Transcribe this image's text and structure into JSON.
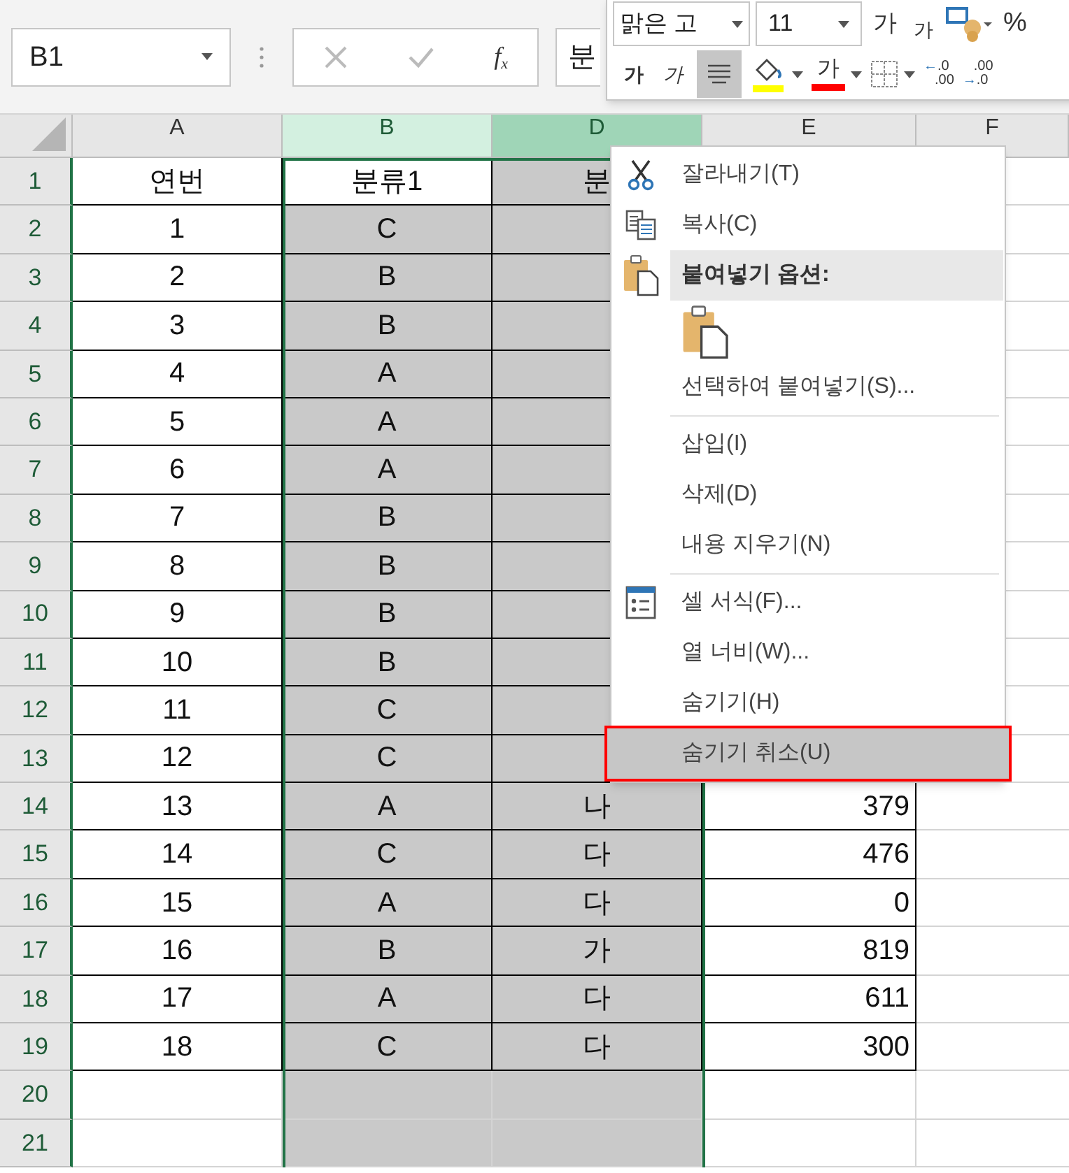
{
  "name_box": {
    "value": "B1"
  },
  "formula_bar": {
    "value": "분",
    "function_icon": [
      "f",
      "x"
    ]
  },
  "mini_toolbar": {
    "font": "맑은 고",
    "size": "11",
    "grow_font": "가",
    "shrink_font": "가",
    "percent": "%",
    "bold": "가",
    "italic": "가",
    "align_center_selected": true,
    "font_color": "가",
    "increase_decimal": [
      "←",
      ".0",
      ".00"
    ],
    "decrease_decimal": [
      ".00",
      "→",
      ".0"
    ]
  },
  "columns": [
    {
      "label": "A",
      "selected": false
    },
    {
      "label": "B",
      "selected": true,
      "active": false
    },
    {
      "label": "D",
      "selected": true,
      "active": true
    },
    {
      "label": "E",
      "selected": false
    },
    {
      "label": "F",
      "selected": false
    }
  ],
  "rows": [
    {
      "num": "1",
      "a": "연번",
      "b": "분류1",
      "d": "분"
    },
    {
      "num": "2",
      "a": "1",
      "b": "C"
    },
    {
      "num": "3",
      "a": "2",
      "b": "B"
    },
    {
      "num": "4",
      "a": "3",
      "b": "B"
    },
    {
      "num": "5",
      "a": "4",
      "b": "A"
    },
    {
      "num": "6",
      "a": "5",
      "b": "A"
    },
    {
      "num": "7",
      "a": "6",
      "b": "A"
    },
    {
      "num": "8",
      "a": "7",
      "b": "B"
    },
    {
      "num": "9",
      "a": "8",
      "b": "B"
    },
    {
      "num": "10",
      "a": "9",
      "b": "B"
    },
    {
      "num": "11",
      "a": "10",
      "b": "B"
    },
    {
      "num": "12",
      "a": "11",
      "b": "C"
    },
    {
      "num": "13",
      "a": "12",
      "b": "C"
    },
    {
      "num": "14",
      "a": "13",
      "b": "A",
      "d": "나",
      "e": "379"
    },
    {
      "num": "15",
      "a": "14",
      "b": "C",
      "d": "다",
      "e": "476"
    },
    {
      "num": "16",
      "a": "15",
      "b": "A",
      "d": "다",
      "e": "0"
    },
    {
      "num": "17",
      "a": "16",
      "b": "B",
      "d": "가",
      "e": "819"
    },
    {
      "num": "18",
      "a": "17",
      "b": "A",
      "d": "다",
      "e": "611"
    },
    {
      "num": "19",
      "a": "18",
      "b": "C",
      "d": "다",
      "e": "300"
    },
    {
      "num": "20"
    },
    {
      "num": "21"
    }
  ],
  "context_menu": {
    "items": [
      {
        "kind": "item",
        "label": "잘라내기(T)",
        "selected": false
      },
      {
        "kind": "item",
        "label": "복사(C)",
        "selected": false
      },
      {
        "kind": "header",
        "label": "붙여넣기 옵션:"
      },
      {
        "kind": "paste-options"
      },
      {
        "kind": "item",
        "label": "선택하여 붙여넣기(S)...",
        "selected": false
      },
      {
        "kind": "separator"
      },
      {
        "kind": "item",
        "label": "삽입(I)",
        "selected": false
      },
      {
        "kind": "item",
        "label": "삭제(D)",
        "selected": false
      },
      {
        "kind": "item",
        "label": "내용 지우기(N)",
        "selected": false
      },
      {
        "kind": "separator"
      },
      {
        "kind": "item",
        "label": "셀 서식(F)...",
        "selected": false
      },
      {
        "kind": "item",
        "label": "열 너비(W)...",
        "selected": false
      },
      {
        "kind": "item",
        "label": "숨기기(H)",
        "selected": false
      },
      {
        "kind": "item",
        "label": "숨기기 취소(U)",
        "selected": true
      }
    ]
  }
}
